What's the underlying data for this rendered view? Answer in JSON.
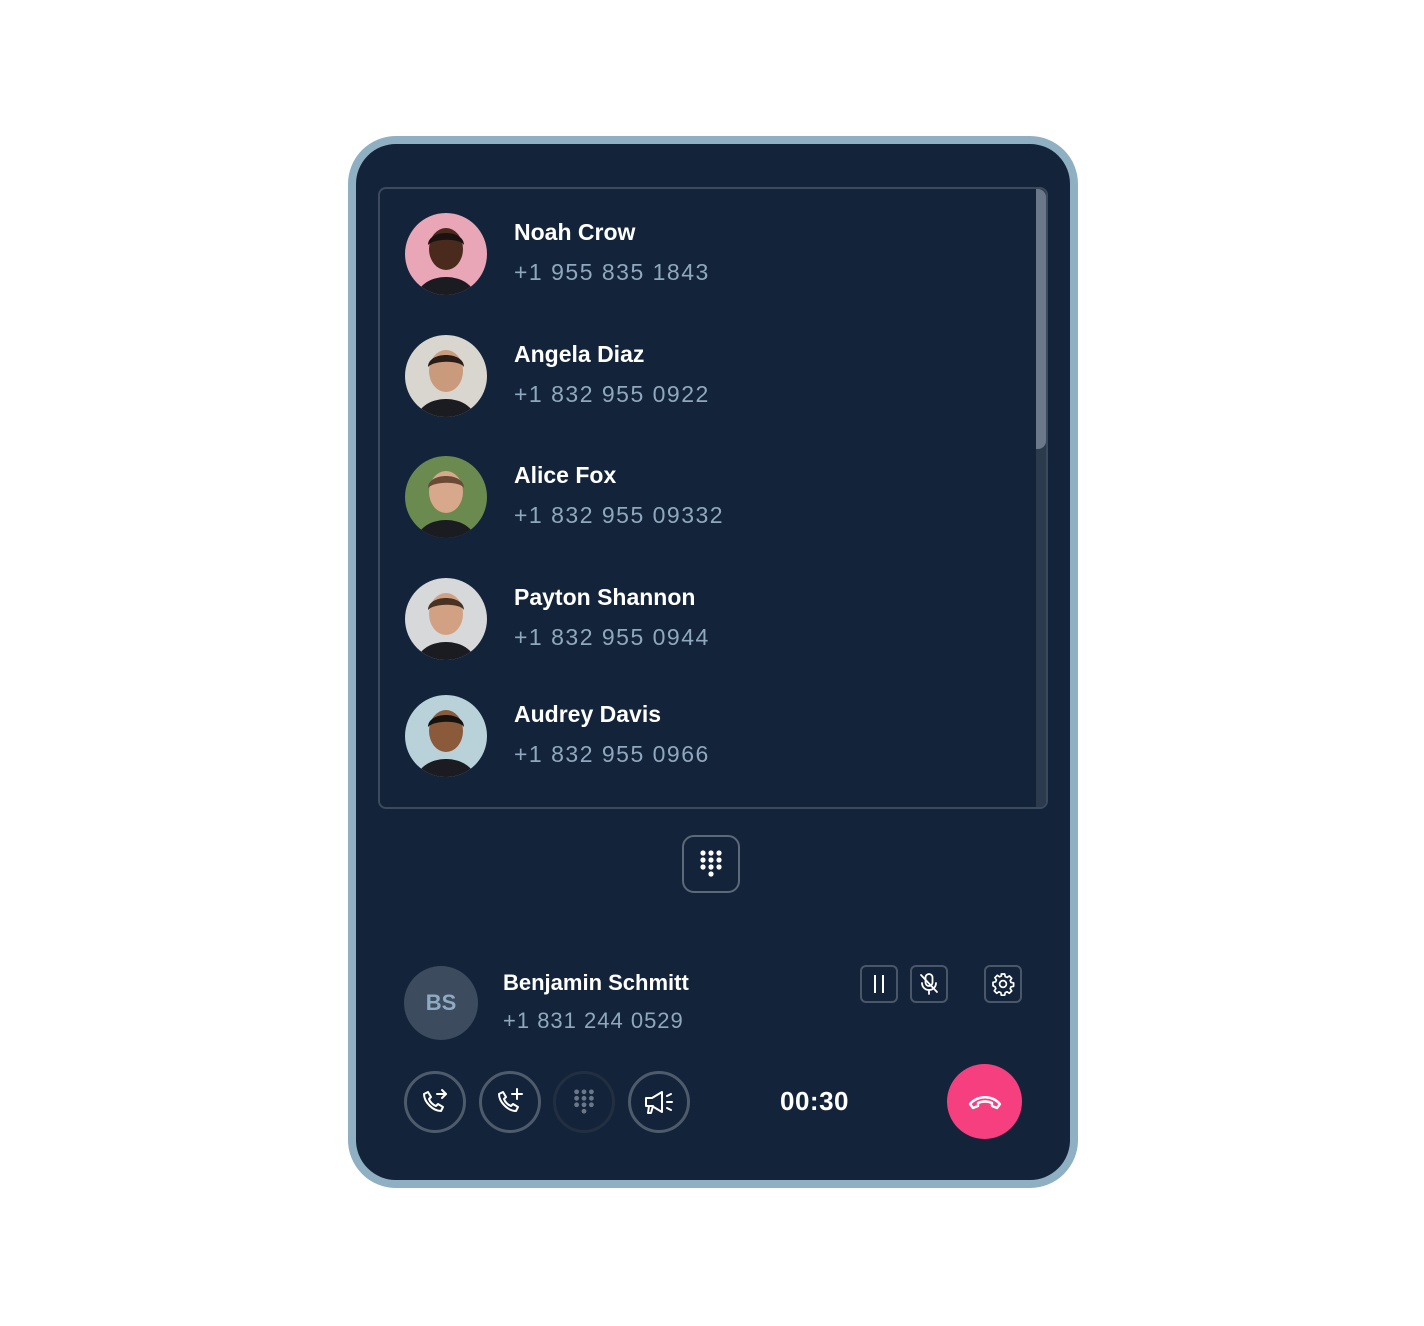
{
  "contacts": [
    {
      "name": "Noah Crow",
      "phone": "+1 955 835 1843",
      "avatar_bg": "#e8a6b7",
      "skin": "#4a2a1c",
      "hair": "#1a1210"
    },
    {
      "name": "Angela Diaz",
      "phone": "+1 832 955 0922",
      "avatar_bg": "#d9d5cf",
      "skin": "#c99a7c",
      "hair": "#2a1c16"
    },
    {
      "name": "Alice Fox",
      "phone": "+1 832 955 09332",
      "avatar_bg": "#6b8a4f",
      "skin": "#d8a88c",
      "hair": "#6a4a34"
    },
    {
      "name": "Payton Shannon",
      "phone": "+1 832 955 0944",
      "avatar_bg": "#d6d8da",
      "skin": "#d2a184",
      "hair": "#4a3222"
    },
    {
      "name": "Audrey Davis",
      "phone": "+1 832 955 0966",
      "avatar_bg": "#b9d2da",
      "skin": "#8a5a3a",
      "hair": "#161210"
    }
  ],
  "active_call": {
    "initials": "BS",
    "name": "Benjamin Schmitt",
    "phone": "+1 831 244 0529",
    "timer": "00:30"
  },
  "colors": {
    "background": "#132339",
    "frame": "#8fb0c3",
    "hangup": "#f63f7f",
    "secondary_text": "#8fa8bd"
  }
}
